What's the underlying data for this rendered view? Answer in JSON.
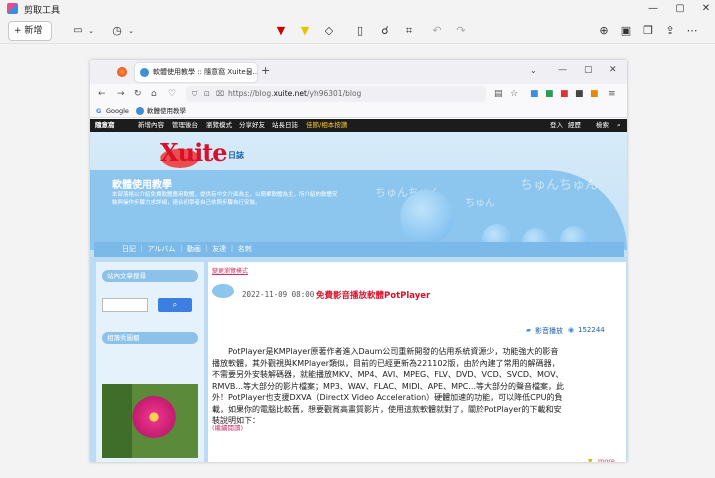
{
  "snip": {
    "title": "剪取工具",
    "new_label": "+ 新增",
    "window_controls": [
      "—",
      "▢",
      "✕"
    ]
  },
  "browser": {
    "tab_title": "軟體使用教學 :: 隨意窩 Xuite日...",
    "url_prefix": "https://blog.",
    "url_domain": "xuite.net",
    "url_path": "/yh96301/blog",
    "bookmarks": [
      "Google",
      "軟體使用教學"
    ]
  },
  "xuite": {
    "topbar_left": [
      "隨意窩",
      "新增內容",
      "管理後台",
      "瀏覽模式",
      "分享好友",
      "站長日誌",
      "佳節/相本按讚"
    ],
    "topbar_right": [
      "登入",
      "經歷",
      "檢索"
    ],
    "logo": "Xuite",
    "logo_sub": "日誌",
    "blog_title": "軟體使用教學",
    "blog_desc_1": "本部落格以介紹免費軟體應用軟體，提供有中文介面為主，以簡單軟體為主，所介紹的軟體安",
    "blog_desc_2": "裝與操作步驟力求詳細，適合初學者自己依照步驟自行安裝。",
    "nav": [
      "日記",
      "アルバム",
      "動画",
      "友達",
      "名刺"
    ],
    "sidebar_search_title": "站內文章搜尋",
    "sidebar_photo_title": "相簿秀圖櫃",
    "browse_mode_link": "變更瀏覽模式",
    "post_date": "2022-11-09 08:00",
    "post_title": "免費影音播放軟體PotPlayer",
    "post_category": "影音播放",
    "post_views": "152244",
    "post_body": "PotPlayer是KMPlayer原著作者進入Daum公司重新開發的佔用系統資源少，功能強大的影音播放軟體，其外觀視與KMPlayer類似，目前的已經更新為221102版，由於內建了常用的解碼器，不需要另外安裝解碼器，就能播放MKV、MP4、AVI、MPEG、FLV、DVD、VCD、SVCD、MOV、RMVB...等大部分的影片檔案；MP3、WAV、FLAC、MIDI、APE、MPC...等大部分的聲音檔案，此外！PotPlayer也支援DXVA（DirectX Video Acceleration）硬體加速的功能，可以降低CPU的負載，如果你的電腦比較舊，想要觀賞高畫質影片，使用這款軟體就對了，關於PotPlayer的下載和安裝說明如下：",
    "read_more": "(繼續閱讀)",
    "more": "more"
  },
  "colors": {
    "accent": "#3d8fd6",
    "title_red": "#d8102a",
    "header_blue": "#bcdcf6"
  }
}
